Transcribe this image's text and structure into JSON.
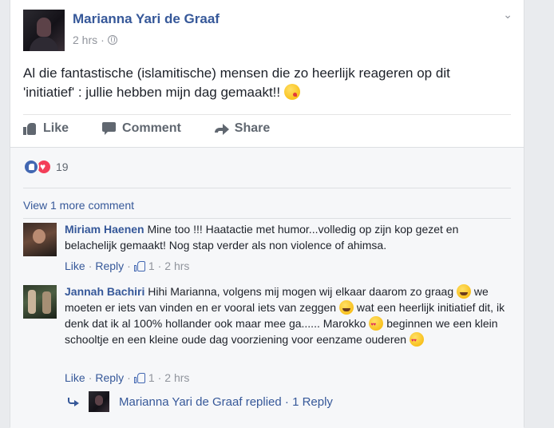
{
  "post": {
    "author": "Marianna Yari de Graaf",
    "time": "2 hrs",
    "time_sep": " · ",
    "text": "Al die fantastische (islamitische) mensen die zo heerlijk reageren op dit 'initiatief' : jullie hebben mijn dag gemaakt!! ",
    "emoji": "kissing-heart-emoji"
  },
  "actions": {
    "like": "Like",
    "comment": "Comment",
    "share": "Share"
  },
  "reactions": {
    "types": [
      "like",
      "love"
    ],
    "count": "19"
  },
  "view_more": "View 1 more comment",
  "comments": [
    {
      "author": "Miriam Haenen",
      "text": "Mine too !!! Haatactie met humor...volledig op zijn kop gezet en belachelijk gemaakt! Nog stap verder als non violence of ahimsa.",
      "like": "Like",
      "reply": "Reply",
      "likes": "1",
      "time": "2 hrs"
    },
    {
      "author": "Jannah Bachiri",
      "text_parts": [
        "Hihi Marianna, volgens mij mogen wij elkaar daarom zo graag ",
        " we moeten er iets van vinden en er vooral iets van zeggen ",
        " wat een heerlijk initiatief dit, ik denk dat ik al 100% hollander ook maar mee ga...... Marokko ",
        " beginnen we een klein schooltje en een kleine oude dag voorziening voor eenzame ouderen "
      ],
      "like": "Like",
      "reply": "Reply",
      "likes": "1",
      "time": "2 hrs"
    }
  ],
  "reply_summary": {
    "author": "Marianna Yari de Graaf",
    "replied": " replied · ",
    "count": "1 Reply"
  },
  "colors": {
    "link": "#365899",
    "muted": "#90949c",
    "background": "#e9ebee",
    "like_blue": "#4267b2",
    "love_red": "#f33e58"
  }
}
